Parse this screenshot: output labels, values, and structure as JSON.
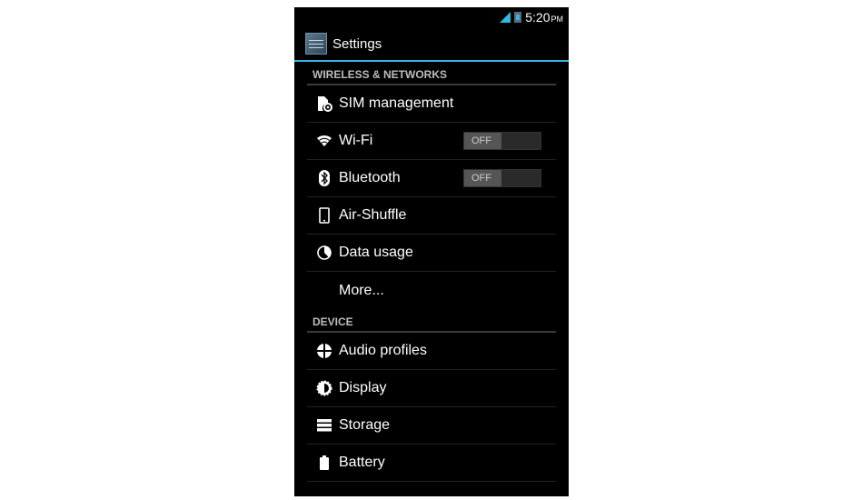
{
  "status_bar": {
    "icons": [
      "signal-icon",
      "battery-charging-icon"
    ],
    "time": "5:20",
    "ampm": "PM"
  },
  "action_bar": {
    "icon": "settings-app-icon",
    "title": "Settings"
  },
  "sections": [
    {
      "header": "WIRELESS & NETWORKS",
      "items": [
        {
          "label": "SIM management",
          "icon": "sim-management-icon"
        },
        {
          "label": "Wi-Fi",
          "icon": "wifi-icon",
          "toggle": "OFF"
        },
        {
          "label": "Bluetooth",
          "icon": "bluetooth-icon",
          "toggle": "OFF"
        },
        {
          "label": "Air-Shuffle",
          "icon": "phone-icon"
        },
        {
          "label": "Data usage",
          "icon": "data-usage-icon"
        },
        {
          "label": "More..."
        }
      ]
    },
    {
      "header": "DEVICE",
      "items": [
        {
          "label": "Audio profiles",
          "icon": "audio-profiles-icon"
        },
        {
          "label": "Display",
          "icon": "display-icon"
        },
        {
          "label": "Storage",
          "icon": "storage-icon"
        },
        {
          "label": "Battery",
          "icon": "battery-icon"
        }
      ]
    }
  ]
}
